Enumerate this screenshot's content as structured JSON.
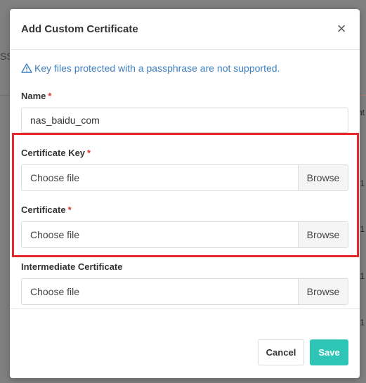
{
  "background": {
    "tab_fragment": "SSI",
    "right_fragments": [
      "nt",
      "1",
      "1",
      "1",
      "1"
    ]
  },
  "dialog": {
    "title": "Add Custom Certificate",
    "close_glyph": "×",
    "notice_icon": "warning-triangle-icon",
    "notice": "Key files protected with a passphrase are not supported.",
    "required_mark": "*"
  },
  "fields": {
    "name": {
      "label": "Name",
      "value": "nas_baidu_com"
    },
    "certificate_key": {
      "label": "Certificate Key",
      "placeholder": "Choose file",
      "browse": "Browse"
    },
    "certificate": {
      "label": "Certificate",
      "placeholder": "Choose file",
      "browse": "Browse"
    },
    "intermediate_certificate": {
      "label": "Intermediate Certificate",
      "placeholder": "Choose file",
      "browse": "Browse"
    }
  },
  "footer": {
    "cancel": "Cancel",
    "save": "Save"
  },
  "colors": {
    "accent": "#2ec4b6",
    "notice_text": "#3f7fbf",
    "required": "#d9342b",
    "highlight_box": "#e5282b"
  }
}
